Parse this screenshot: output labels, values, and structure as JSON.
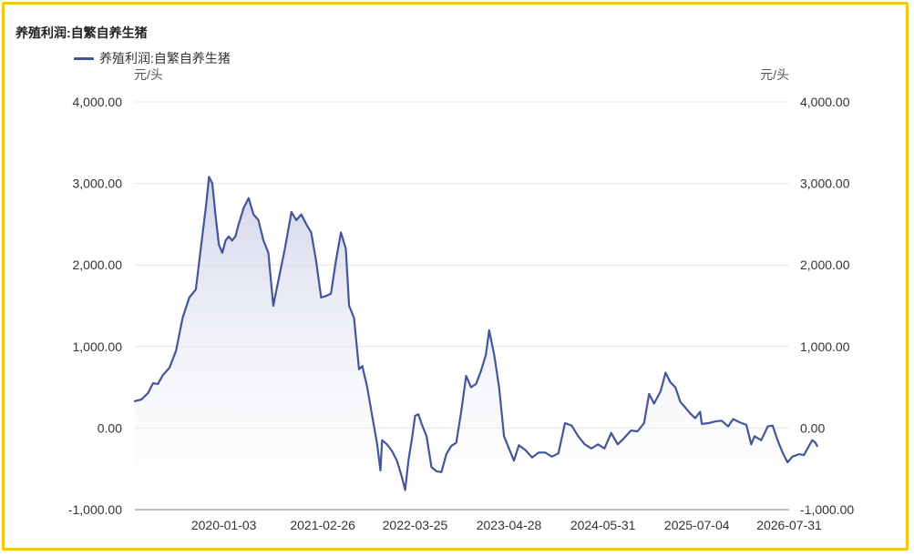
{
  "title": "养殖利润:自繁自养生猪",
  "colors": {
    "line": "#44559a",
    "frame": "#f5c518",
    "grid": "#e6e6e6",
    "axis_text": "#333333"
  },
  "chart_data": {
    "type": "area",
    "title": "养殖利润:自繁自养生猪",
    "legend_position": "top-left",
    "grid": true,
    "y_unit_left": "元/头",
    "y_unit_right": "元/头",
    "ylim": [
      -1000,
      4000
    ],
    "y_ticks": [
      "4,000.00",
      "3,000.00",
      "2,000.00",
      "1,000.00",
      "0.00",
      "-1,000.00"
    ],
    "x_tick_labels": [
      "2020-01-03",
      "2021-02-26",
      "2022-03-25",
      "2023-04-28",
      "2024-05-31",
      "2025-07-04",
      "2026-07-31"
    ],
    "x_range": [
      "2018-12-21",
      "2026-07-31"
    ],
    "series": [
      {
        "name": "养殖利润:自繁自养生猪",
        "points": [
          [
            "2018-12-21",
            330
          ],
          [
            "2019-01-18",
            350
          ],
          [
            "2019-02-15",
            430
          ],
          [
            "2019-03-08",
            550
          ],
          [
            "2019-03-29",
            540
          ],
          [
            "2019-04-19",
            650
          ],
          [
            "2019-05-17",
            740
          ],
          [
            "2019-06-14",
            950
          ],
          [
            "2019-07-12",
            1350
          ],
          [
            "2019-08-09",
            1600
          ],
          [
            "2019-09-06",
            1700
          ],
          [
            "2019-09-27",
            2200
          ],
          [
            "2019-10-18",
            2700
          ],
          [
            "2019-11-01",
            3080
          ],
          [
            "2019-11-15",
            3000
          ],
          [
            "2019-11-29",
            2600
          ],
          [
            "2019-12-13",
            2250
          ],
          [
            "2019-12-27",
            2150
          ],
          [
            "2020-01-10",
            2300
          ],
          [
            "2020-01-24",
            2350
          ],
          [
            "2020-02-07",
            2300
          ],
          [
            "2020-02-21",
            2350
          ],
          [
            "2020-03-06",
            2500
          ],
          [
            "2020-03-27",
            2700
          ],
          [
            "2020-04-17",
            2820
          ],
          [
            "2020-05-08",
            2620
          ],
          [
            "2020-05-29",
            2550
          ],
          [
            "2020-06-19",
            2300
          ],
          [
            "2020-07-10",
            2150
          ],
          [
            "2020-07-31",
            1500
          ],
          [
            "2020-08-21",
            1800
          ],
          [
            "2020-09-18",
            2200
          ],
          [
            "2020-10-16",
            2650
          ],
          [
            "2020-11-06",
            2550
          ],
          [
            "2020-11-27",
            2620
          ],
          [
            "2020-12-18",
            2500
          ],
          [
            "2021-01-08",
            2400
          ],
          [
            "2021-01-29",
            2050
          ],
          [
            "2021-02-19",
            1600
          ],
          [
            "2021-03-12",
            1620
          ],
          [
            "2021-04-02",
            1650
          ],
          [
            "2021-04-23",
            2050
          ],
          [
            "2021-05-14",
            2400
          ],
          [
            "2021-06-04",
            2200
          ],
          [
            "2021-06-18",
            1500
          ],
          [
            "2021-07-09",
            1350
          ],
          [
            "2021-07-30",
            720
          ],
          [
            "2021-08-13",
            760
          ],
          [
            "2021-09-03",
            500
          ],
          [
            "2021-09-24",
            150
          ],
          [
            "2021-10-15",
            -200
          ],
          [
            "2021-10-29",
            -520
          ],
          [
            "2021-11-05",
            -150
          ],
          [
            "2021-11-26",
            -200
          ],
          [
            "2021-12-17",
            -280
          ],
          [
            "2022-01-07",
            -400
          ],
          [
            "2022-01-28",
            -600
          ],
          [
            "2022-02-11",
            -760
          ],
          [
            "2022-02-25",
            -400
          ],
          [
            "2022-03-11",
            -150
          ],
          [
            "2022-03-25",
            150
          ],
          [
            "2022-04-08",
            170
          ],
          [
            "2022-04-22",
            50
          ],
          [
            "2022-05-13",
            -100
          ],
          [
            "2022-06-03",
            -480
          ],
          [
            "2022-06-24",
            -530
          ],
          [
            "2022-07-15",
            -540
          ],
          [
            "2022-08-05",
            -320
          ],
          [
            "2022-08-26",
            -220
          ],
          [
            "2022-09-16",
            -180
          ],
          [
            "2022-10-07",
            200
          ],
          [
            "2022-10-28",
            640
          ],
          [
            "2022-11-18",
            500
          ],
          [
            "2022-12-09",
            540
          ],
          [
            "2022-12-30",
            700
          ],
          [
            "2023-01-20",
            900
          ],
          [
            "2023-02-03",
            1200
          ],
          [
            "2023-02-24",
            900
          ],
          [
            "2023-03-17",
            500
          ],
          [
            "2023-04-07",
            -100
          ],
          [
            "2023-04-28",
            -250
          ],
          [
            "2023-05-19",
            -400
          ],
          [
            "2023-06-09",
            -210
          ],
          [
            "2023-07-07",
            -270
          ],
          [
            "2023-08-04",
            -360
          ],
          [
            "2023-09-01",
            -300
          ],
          [
            "2023-09-29",
            -300
          ],
          [
            "2023-10-27",
            -350
          ],
          [
            "2023-11-24",
            -310
          ],
          [
            "2023-12-22",
            60
          ],
          [
            "2024-01-19",
            30
          ],
          [
            "2024-02-16",
            -100
          ],
          [
            "2024-03-15",
            -200
          ],
          [
            "2024-04-12",
            -250
          ],
          [
            "2024-05-10",
            -200
          ],
          [
            "2024-06-07",
            -250
          ],
          [
            "2024-07-05",
            -60
          ],
          [
            "2024-08-02",
            -200
          ],
          [
            "2024-08-30",
            -120
          ],
          [
            "2024-09-27",
            -30
          ],
          [
            "2024-10-25",
            -40
          ],
          [
            "2024-11-22",
            60
          ],
          [
            "2024-12-13",
            420
          ],
          [
            "2025-01-03",
            300
          ],
          [
            "2025-01-31",
            450
          ],
          [
            "2025-02-21",
            680
          ],
          [
            "2025-03-14",
            560
          ],
          [
            "2025-04-04",
            500
          ],
          [
            "2025-04-25",
            320
          ],
          [
            "2025-05-16",
            250
          ],
          [
            "2025-06-06",
            180
          ],
          [
            "2025-06-27",
            120
          ],
          [
            "2025-07-18",
            200
          ],
          [
            "2025-07-25",
            50
          ],
          [
            "2025-08-22",
            60
          ],
          [
            "2025-09-19",
            80
          ],
          [
            "2025-10-17",
            90
          ],
          [
            "2025-11-14",
            20
          ],
          [
            "2025-12-05",
            110
          ],
          [
            "2026-01-02",
            70
          ],
          [
            "2026-01-30",
            40
          ],
          [
            "2026-02-20",
            -200
          ],
          [
            "2026-03-06",
            -100
          ],
          [
            "2026-04-03",
            -150
          ],
          [
            "2026-05-01",
            20
          ],
          [
            "2026-05-22",
            30
          ],
          [
            "2026-06-12",
            -150
          ],
          [
            "2026-07-03",
            -300
          ],
          [
            "2026-07-24",
            -420
          ],
          [
            "2026-08-14",
            -350
          ],
          [
            "2026-09-11",
            -320
          ],
          [
            "2026-10-02",
            -330
          ],
          [
            "2026-10-23",
            -220
          ],
          [
            "2026-11-06",
            -150
          ],
          [
            "2026-11-20",
            -180
          ],
          [
            "2026-11-27",
            -220
          ]
        ]
      }
    ]
  }
}
